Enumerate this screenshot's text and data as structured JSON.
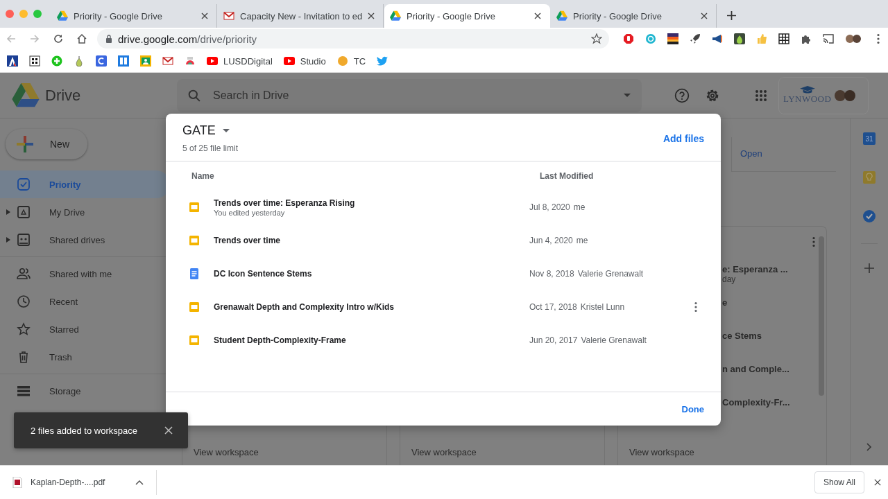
{
  "browser": {
    "tabs": [
      {
        "title": "Priority - Google Drive",
        "kind": "drive",
        "selected": false
      },
      {
        "title": "Capacity New - Invitation to ed",
        "kind": "mail",
        "selected": false
      },
      {
        "title": "Priority - Google Drive",
        "kind": "drive",
        "selected": true
      },
      {
        "title": "Priority - Google Drive",
        "kind": "drive",
        "selected": false
      }
    ],
    "url": {
      "host": "drive.google.com",
      "path": "/drive/priority"
    },
    "bookmarks": [
      {
        "label": "LUSDDigital",
        "kind": "video"
      },
      {
        "label": "Studio",
        "kind": "video"
      },
      {
        "label": "TC",
        "kind": "dot"
      }
    ]
  },
  "drive": {
    "app_name": "Drive",
    "search": {
      "placeholder": "Search in Drive"
    },
    "account_logo": "LYNWOOD",
    "new_button": "New",
    "sidebar": {
      "groups": [
        [
          {
            "label": "Priority",
            "kind": "priority",
            "selected": true,
            "expandable": false
          },
          {
            "label": "My Drive",
            "kind": "my-drive",
            "selected": false,
            "expandable": true
          },
          {
            "label": "Shared drives",
            "kind": "shared-drives",
            "selected": false,
            "expandable": true
          }
        ],
        [
          {
            "label": "Shared with me",
            "kind": "people",
            "selected": false,
            "expandable": false
          },
          {
            "label": "Recent",
            "kind": "clock",
            "selected": false,
            "expandable": false
          },
          {
            "label": "Starred",
            "kind": "star",
            "selected": false,
            "expandable": false
          },
          {
            "label": "Trash",
            "kind": "trash",
            "selected": false,
            "expandable": false
          }
        ],
        [
          {
            "label": "Storage",
            "kind": "storage",
            "selected": false,
            "expandable": false
          }
        ]
      ]
    },
    "top_card_link": "Open",
    "calendar_day": "31",
    "workspace_cards": [
      {
        "link": "View workspace"
      },
      {
        "link": "View workspace"
      },
      {
        "lines": [
          {
            "title": "e: Esperanza ...",
            "subtitle": "day"
          },
          {
            "title": "e"
          },
          {
            "title": "ce Stems"
          },
          {
            "title": "n and Comple..."
          },
          {
            "title": "Complexity-Fr..."
          }
        ],
        "link": "View workspace"
      }
    ]
  },
  "dialog": {
    "title": "GATE",
    "subtitle": "5 of 25 file limit",
    "action": "Add files",
    "columns": [
      "Name",
      "Last Modified"
    ],
    "rows": [
      {
        "kind": "slides",
        "name": "Trends over time: Esperanza Rising",
        "detail": "You edited yesterday",
        "date": "Jul 8, 2020",
        "modified_by": "me",
        "hovered": false
      },
      {
        "kind": "slides",
        "name": "Trends over time",
        "date": "Jun 4, 2020",
        "modified_by": "me",
        "hovered": false
      },
      {
        "kind": "doc",
        "name": "DC Icon Sentence Stems",
        "date": "Nov 8, 2018",
        "modified_by": "Valerie Grenawalt",
        "hovered": false
      },
      {
        "kind": "slides",
        "name": "Grenawalt Depth and Complexity Intro w/Kids",
        "date": "Oct 17, 2018",
        "modified_by": "Kristel Lunn",
        "hovered": true
      },
      {
        "kind": "slides",
        "name": "Student Depth-Complexity-Frame",
        "date": "Jun 20, 2017",
        "modified_by": "Valerie Grenawalt",
        "hovered": false
      }
    ],
    "done": "Done"
  },
  "snackbar": {
    "message": "2 files added to workspace"
  },
  "downloads": {
    "file": "Kaplan-Depth-....pdf",
    "show_all": "Show All"
  }
}
